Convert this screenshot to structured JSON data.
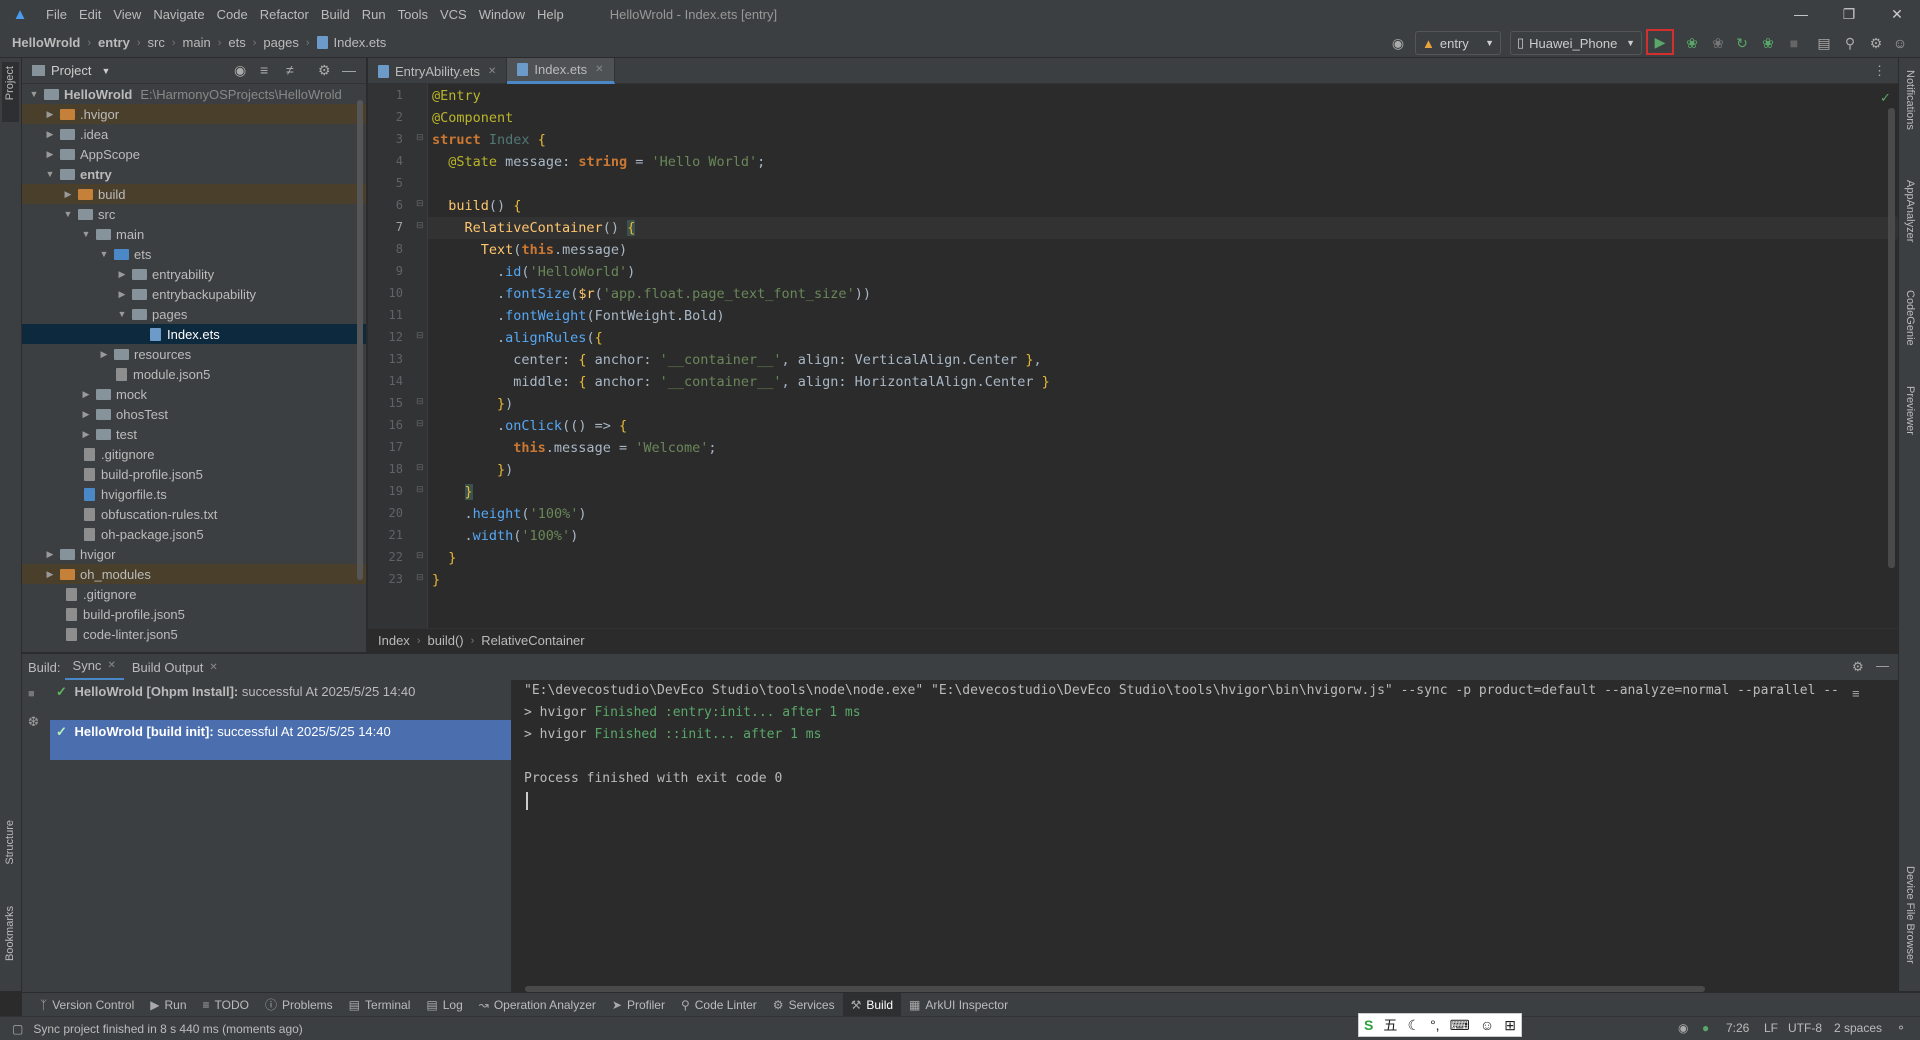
{
  "app": {
    "window_title": "HelloWrold - Index.ets [entry]"
  },
  "menu": [
    "File",
    "Edit",
    "View",
    "Navigate",
    "Code",
    "Refactor",
    "Build",
    "Run",
    "Tools",
    "VCS",
    "Window",
    "Help"
  ],
  "breadcrumb": [
    "HelloWrold",
    "entry",
    "src",
    "main",
    "ets",
    "pages",
    "Index.ets"
  ],
  "toolbar": {
    "module_label": "entry",
    "device_label": "Huawei_Phone"
  },
  "project": {
    "header": "Project",
    "root_name": "HelloWrold",
    "root_path": "E:\\HarmonyOSProjects\\HelloWrold",
    "items": [
      {
        "label": ".hvigor"
      },
      {
        "label": ".idea"
      },
      {
        "label": "AppScope"
      },
      {
        "label": "entry"
      },
      {
        "label": "build"
      },
      {
        "label": "src"
      },
      {
        "label": "main"
      },
      {
        "label": "ets"
      },
      {
        "label": "entryability"
      },
      {
        "label": "entrybackupability"
      },
      {
        "label": "pages"
      },
      {
        "label": "Index.ets"
      },
      {
        "label": "resources"
      },
      {
        "label": "module.json5"
      },
      {
        "label": "mock"
      },
      {
        "label": "ohosTest"
      },
      {
        "label": "test"
      },
      {
        "label": ".gitignore"
      },
      {
        "label": "build-profile.json5"
      },
      {
        "label": "hvigorfile.ts"
      },
      {
        "label": "obfuscation-rules.txt"
      },
      {
        "label": "oh-package.json5"
      },
      {
        "label": "hvigor"
      },
      {
        "label": "oh_modules"
      },
      {
        "label": ".gitignore"
      },
      {
        "label": "build-profile.json5"
      },
      {
        "label": "code-linter.json5"
      }
    ]
  },
  "editor": {
    "tabs": [
      {
        "label": "EntryAbility.ets"
      },
      {
        "label": "Index.ets"
      }
    ],
    "line_numbers": [
      "1",
      "2",
      "3",
      "4",
      "5",
      "6",
      "7",
      "8",
      "9",
      "10",
      "11",
      "12",
      "13",
      "14",
      "15",
      "16",
      "17",
      "18",
      "19",
      "20",
      "21",
      "22",
      "23"
    ],
    "crumbs": [
      "Index",
      "build()",
      "RelativeContainer"
    ]
  },
  "build": {
    "label": "Build:",
    "tabs": [
      {
        "label": "Sync"
      },
      {
        "label": "Build Output"
      }
    ],
    "tasks": [
      {
        "title": "HelloWrold [Ohpm Install]:",
        "status": "successful At 2025/5/25 14:40"
      },
      {
        "title": "HelloWrold [build init]:",
        "status": "successful At 2025/5/25 14:40"
      }
    ],
    "output": {
      "cmd": "\"E:\\devecostudio\\DevEco Studio\\tools\\node\\node.exe\" \"E:\\devecostudio\\DevEco Studio\\tools\\hvigor\\bin\\hvigorw.js\" --sync -p product=default --analyze=normal --parallel --",
      "line1_prefix": "> hvigor ",
      "line1_msg": "Finished :entry:init... after 1 ms",
      "line2_prefix": "> hvigor ",
      "line2_msg": "Finished ::init... after 1 ms",
      "exit": "Process finished with exit code 0"
    }
  },
  "tool_windows": [
    "Version Control",
    "Run",
    "TODO",
    "Problems",
    "Terminal",
    "Log",
    "Operation Analyzer",
    "Profiler",
    "Code Linter",
    "Services",
    "Build",
    "ArkUI Inspector"
  ],
  "left_strip": [
    "Project",
    "Structure",
    "Bookmarks"
  ],
  "right_strip": [
    "Notifications",
    "AppAnalyzer",
    "CodeGenie",
    "Previewer",
    "Device File Browser"
  ],
  "status": {
    "message": "Sync project finished in 8 s 440 ms (moments ago)",
    "position": "7:26",
    "line_sep": "LF",
    "encoding": "UTF-8",
    "indent": "2 spaces"
  },
  "ime": {
    "label": "五"
  }
}
